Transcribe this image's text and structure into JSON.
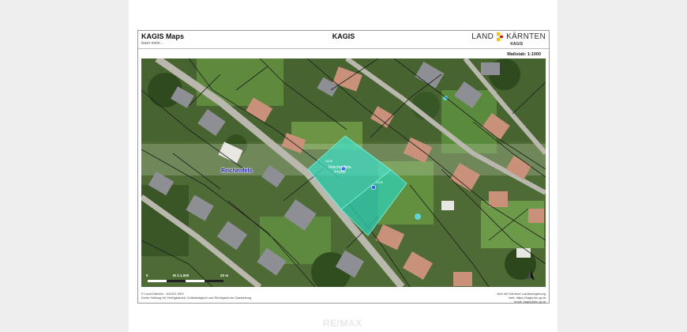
{
  "header": {
    "title": "KAGIS Maps",
    "subtitle": "learn mehr...",
    "center_title": "KAGIS",
    "brand_left": "LAND",
    "brand_right": "KÄRNTEN",
    "brand_sub": "KAGIS",
    "scale": "Maßstab: 1:1000"
  },
  "map": {
    "place_label": "Reichenfels",
    "parcel_label_1": "Reichenfels",
    "parcel_label_2": "Frohn",
    "parcel_num_1": "2426",
    "parcel_num_2": "2425",
    "scalebar_start": "0",
    "scalebar_mid": "M 1:1.000",
    "scalebar_end": "20 m",
    "north_icon": "north-arrow-icon",
    "pin_icon": "map-pin-icon"
  },
  "footer": {
    "left_1": "© Land Kärnten - KAGIS, BEV",
    "left_2": "Keine Haftung für Verfügbarkeit, Vollständigkeit und Richtigkeit der Darstellung",
    "right_1": "Amt der Kärntner Landesregierung",
    "right_2": "web: https://kagis.ktn.gv.at",
    "right_3": "email: kagis@ktn.gv.at"
  },
  "watermark": "RE/MAX",
  "colors": {
    "parcel": "#3fe0c8",
    "place_label": "#1a1aa8",
    "boundary": "#1c1c1c"
  }
}
